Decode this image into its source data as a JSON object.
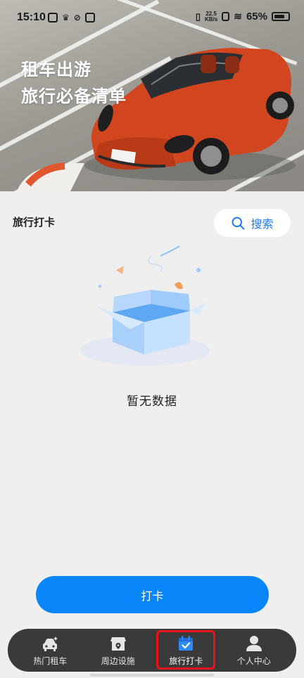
{
  "status_bar": {
    "time": "15:10",
    "net_speed": "22.5",
    "net_unit": "KB/s",
    "battery": "65%"
  },
  "hero": {
    "title_line1": "租车出游",
    "title_line2": "旅行必备清单",
    "car_color": "#d2461f"
  },
  "section": {
    "title": "旅行打卡",
    "search_label": "搜索"
  },
  "empty": {
    "text": "暂无数据"
  },
  "action": {
    "checkin_label": "打卡"
  },
  "tabbar": {
    "items": [
      {
        "label": "热门租车",
        "icon": "car-icon"
      },
      {
        "label": "周边设施",
        "icon": "shop-location-icon"
      },
      {
        "label": "旅行打卡",
        "icon": "calendar-check-icon",
        "active": true
      },
      {
        "label": "个人中心",
        "icon": "user-icon"
      }
    ]
  },
  "colors": {
    "accent": "#0a86fb",
    "search_text": "#1f7cf4",
    "tabbar_bg": "#3a3a3a",
    "highlight_box": "#e8131b"
  }
}
